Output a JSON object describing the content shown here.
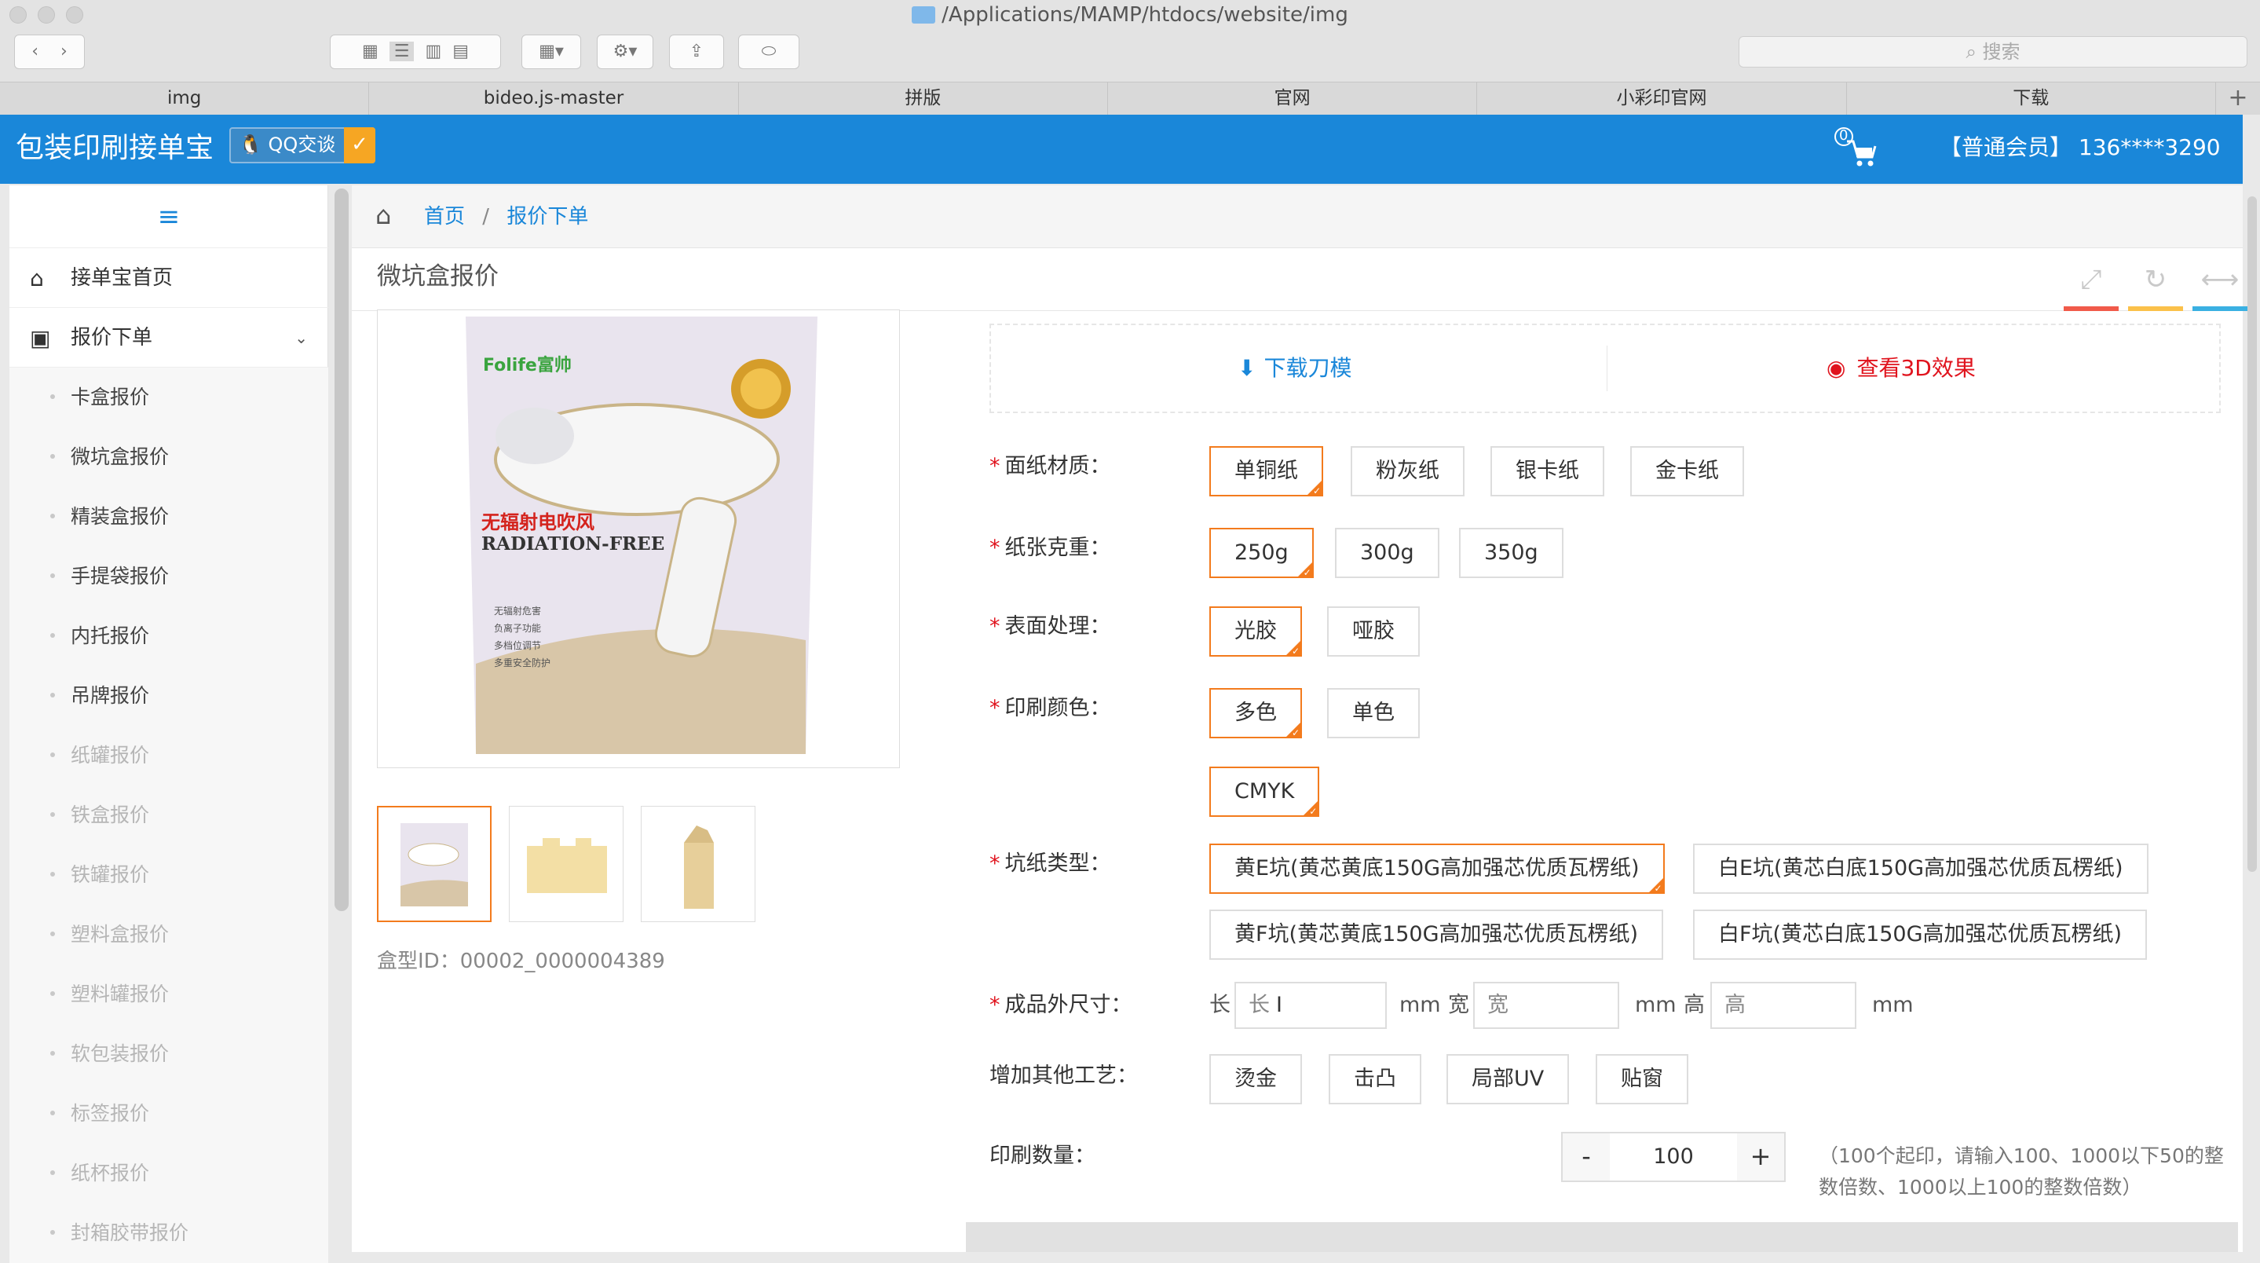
{
  "finder": {
    "path": "/Applications/MAMP/htdocs/website/img",
    "search_placeholder": "搜索",
    "tabs": [
      "img",
      "bideo.js-master",
      "拼版",
      "官网",
      "小彩印官网",
      "下载"
    ],
    "add_tab": "+"
  },
  "header": {
    "brand": "包装印刷接单宝",
    "qq_label": "QQ交谈",
    "cart_count": "0",
    "member": "【普通会员】 136****3290"
  },
  "sidebar": {
    "toggle_icon": "≡",
    "items": [
      {
        "label": "接单宝首页",
        "icon": "home-icon"
      },
      {
        "label": "报价下单",
        "icon": "chart-icon",
        "expanded": true
      }
    ],
    "subitems": [
      {
        "label": "卡盒报价",
        "enabled": true
      },
      {
        "label": "微坑盒报价",
        "enabled": true
      },
      {
        "label": "精装盒报价",
        "enabled": true
      },
      {
        "label": "手提袋报价",
        "enabled": true
      },
      {
        "label": "内托报价",
        "enabled": true
      },
      {
        "label": "吊牌报价",
        "enabled": true
      },
      {
        "label": "纸罐报价",
        "enabled": false
      },
      {
        "label": "铁盒报价",
        "enabled": false
      },
      {
        "label": "铁罐报价",
        "enabled": false
      },
      {
        "label": "塑料盒报价",
        "enabled": false
      },
      {
        "label": "塑料罐报价",
        "enabled": false
      },
      {
        "label": "软包装报价",
        "enabled": false
      },
      {
        "label": "标签报价",
        "enabled": false
      },
      {
        "label": "纸杯报价",
        "enabled": false
      },
      {
        "label": "封箱胶带报价",
        "enabled": false
      }
    ]
  },
  "breadcrumb": {
    "home": "首页",
    "sep": "/",
    "current": "报价下单"
  },
  "panel": {
    "title": "微坑盒报价",
    "box_id_label": "盒型ID：",
    "box_id": "00002_0000004389",
    "product_image": {
      "brand": "Folife富帅",
      "tagline": "无辐射电吹风",
      "headline": "RADIATION-FREE",
      "bullets": [
        "无辐射危害",
        "负离子功能",
        "多档位调节",
        "多重安全防护"
      ]
    },
    "download_label": "下载刀模",
    "view3d_label": "查看3D效果",
    "fields": {
      "paper_label": "面纸材质：",
      "paper_options": [
        "单铜纸",
        "粉灰纸",
        "银卡纸",
        "金卡纸"
      ],
      "weight_label": "纸张克重：",
      "weight_options": [
        "250g",
        "300g",
        "350g"
      ],
      "surface_label": "表面处理：",
      "surface_options": [
        "光胶",
        "哑胶"
      ],
      "color_label": "印刷颜色：",
      "color_options": [
        "多色",
        "单色"
      ],
      "color_sub": "CMYK",
      "flute_label": "坑纸类型：",
      "flute_options": [
        "黄E坑(黄芯黄底150G高加强芯优质瓦楞纸)",
        "白E坑(黄芯白底150G高加强芯优质瓦楞纸)",
        "黄F坑(黄芯黄底150G高加强芯优质瓦楞纸)",
        "白F坑(黄芯白底150G高加强芯优质瓦楞纸)"
      ],
      "size_label": "成品外尺寸：",
      "size": {
        "l_label": "长",
        "l_placeholder": "长",
        "w_label": "宽",
        "w_placeholder": "宽",
        "h_label": "高",
        "h_placeholder": "高",
        "unit": "mm"
      },
      "extra_label": "增加其他工艺：",
      "extra_options": [
        "烫金",
        "击凸",
        "局部UV",
        "贴窗"
      ],
      "qty_label": "印刷数量：",
      "qty_minus": "-",
      "qty_value": "100",
      "qty_plus": "+",
      "qty_note": "（100个起印，请输入100、1000以下50的整数倍数、1000以上100的整数倍数）"
    }
  },
  "colors": {
    "accent": "#1a87d9",
    "selected": "#f37b1d",
    "danger": "#e0141e"
  }
}
